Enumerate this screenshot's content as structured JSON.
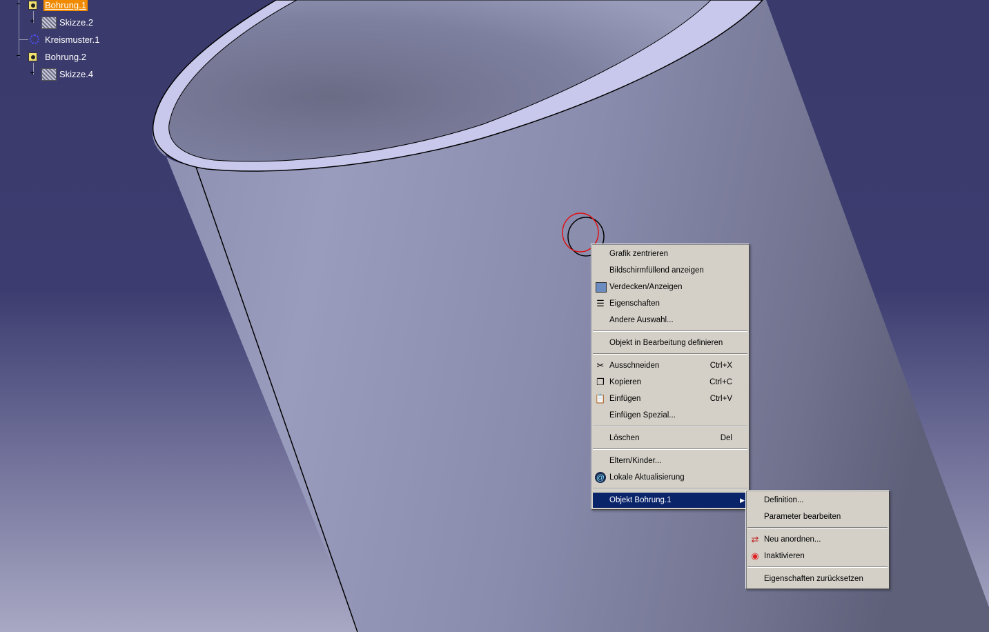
{
  "tree": {
    "items": [
      {
        "label": "Bohrung.1",
        "selected": true,
        "icon": "hole-icon"
      },
      {
        "label": "Skizze.2",
        "icon": "sketch-icon"
      },
      {
        "label": "Kreismuster.1",
        "icon": "circular-pattern-icon"
      },
      {
        "label": "Bohrung.2",
        "icon": "hole-icon"
      },
      {
        "label": "Skizze.4",
        "icon": "sketch-icon"
      }
    ]
  },
  "context_menu": {
    "items": [
      {
        "label": "Grafik zentrieren"
      },
      {
        "label": "Bildschirmfüllend anzeigen"
      },
      {
        "label": "Verdecken/Anzeigen",
        "icon": "hide-show-icon"
      },
      {
        "label": "Eigenschaften",
        "icon": "properties-icon"
      },
      {
        "label": "Andere Auswahl..."
      },
      {
        "label": "Objekt in Bearbeitung definieren"
      },
      {
        "label": "Ausschneiden",
        "shortcut": "Ctrl+X",
        "icon": "scissors-icon"
      },
      {
        "label": "Kopieren",
        "shortcut": "Ctrl+C",
        "icon": "copy-icon"
      },
      {
        "label": "Einfügen",
        "shortcut": "Ctrl+V",
        "icon": "paste-icon"
      },
      {
        "label": "Einfügen Spezial..."
      },
      {
        "label": "Löschen",
        "shortcut": "Del"
      },
      {
        "label": "Eltern/Kinder..."
      },
      {
        "label": "Lokale Aktualisierung",
        "icon": "local-update-icon"
      },
      {
        "label": "Objekt Bohrung.1",
        "highlighted": true,
        "submenu": true
      }
    ]
  },
  "submenu": {
    "items": [
      {
        "label": "Definition..."
      },
      {
        "label": "Parameter bearbeiten"
      },
      {
        "label": "Neu anordnen...",
        "icon": "reorder-icon"
      },
      {
        "label": "Inaktivieren",
        "icon": "deactivate-icon"
      },
      {
        "label": "Eigenschaften zurücksetzen"
      }
    ]
  },
  "colors": {
    "background_top": "#3a3a6c",
    "part_surface": "#9496b8",
    "selection_highlight": "#0a246a",
    "tree_selection": "#f08a00"
  }
}
